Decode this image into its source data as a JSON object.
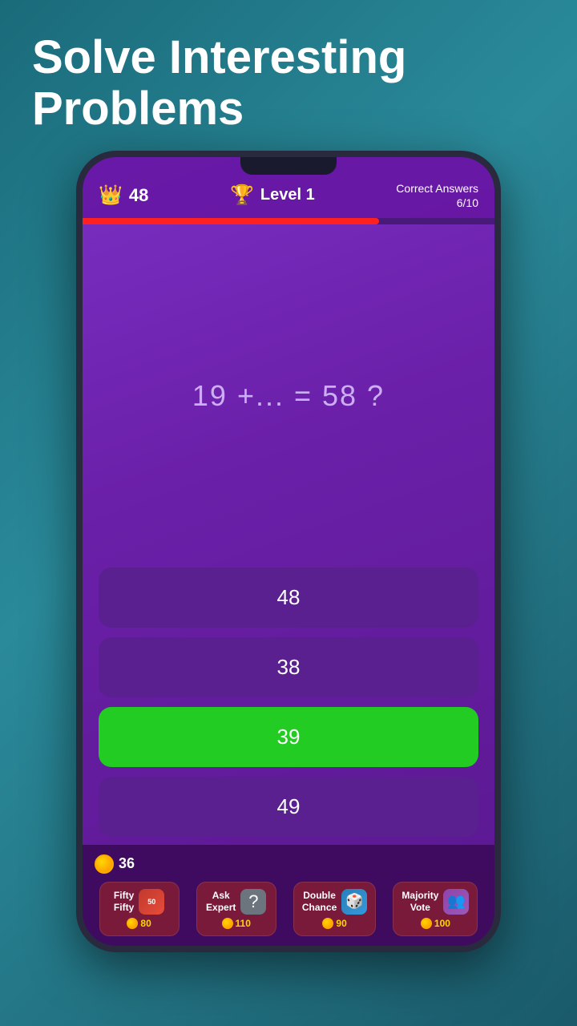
{
  "page": {
    "title_line1": "Solve Interesting",
    "title_line2": "Problems"
  },
  "header": {
    "score": "48",
    "level_label": "Level",
    "level_number": "1",
    "correct_answers_line1": "Correct Answers",
    "correct_answers_line2": "6/10"
  },
  "timer": {
    "progress_percent": 72
  },
  "question": {
    "text": "19 +... = 58 ?"
  },
  "answers": [
    {
      "value": "48",
      "type": "default"
    },
    {
      "value": "38",
      "type": "default"
    },
    {
      "value": "39",
      "type": "correct"
    },
    {
      "value": "49",
      "type": "default"
    }
  ],
  "coins": {
    "count": "36"
  },
  "powerups": [
    {
      "name": "Fifty\nFifty",
      "icon": "50",
      "cost": "80",
      "icon_type": "fifty"
    },
    {
      "name": "Ask\nExpert",
      "icon": "?",
      "cost": "110",
      "icon_type": "ask"
    },
    {
      "name": "Double\nChance",
      "icon": "🎲",
      "cost": "90",
      "icon_type": "chance"
    },
    {
      "name": "Majority\nVote",
      "icon": "👥",
      "cost": "100",
      "icon_type": "vote"
    }
  ]
}
